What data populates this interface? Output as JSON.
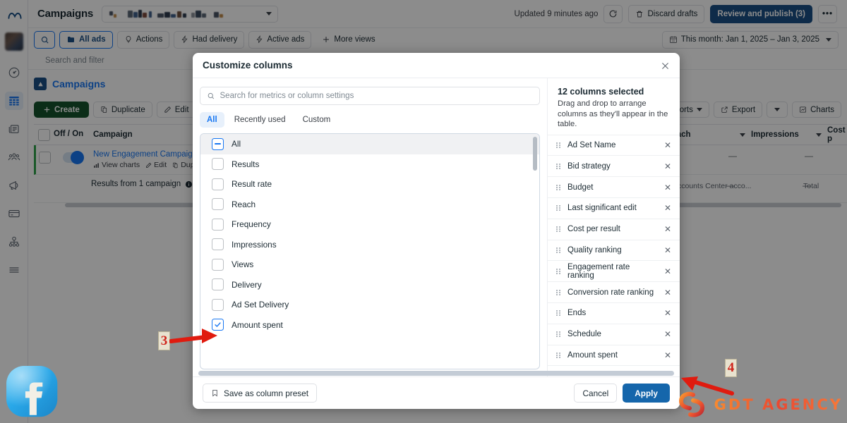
{
  "header": {
    "page_title": "Campaigns",
    "account_placeholder": "",
    "updated_text": "Updated 9 minutes ago",
    "refresh_icon": "refresh-icon",
    "discard_label": "Discard drafts",
    "review_label": "Review and publish (3)",
    "more_label": "•••",
    "date_range": "This month: Jan 1, 2025 – Jan 3, 2025"
  },
  "filters": {
    "search_icon": "search-icon",
    "chips": [
      {
        "label": "All ads",
        "icon": "folder-icon",
        "selected": true
      },
      {
        "label": "Actions",
        "icon": "bulb-icon",
        "selected": false
      },
      {
        "label": "Had delivery",
        "icon": "bolt-icon",
        "selected": false
      },
      {
        "label": "Active ads",
        "icon": "bolt-icon",
        "selected": false
      },
      {
        "label": "More views",
        "icon": "plus-icon",
        "selected": false
      }
    ],
    "search_and_filter": "Search and filter"
  },
  "campaigns_section": {
    "title": "Campaigns",
    "buttons": [
      {
        "label": "Create",
        "icon": "plus-icon"
      },
      {
        "label": "Duplicate",
        "icon": "duplicate-icon"
      },
      {
        "label": "Edit",
        "icon": "pencil-icon"
      }
    ],
    "right_buttons": [
      {
        "label": "eports",
        "icon": "chevron-down-icon"
      },
      {
        "label": "Export",
        "icon": "export-icon"
      },
      {
        "label": "",
        "icon": "chevron-down-icon"
      },
      {
        "label": "Charts",
        "icon": "chart-icon"
      }
    ]
  },
  "table": {
    "columns": [
      "Off / On",
      "Campaign",
      "Reach",
      "Impressions",
      "Cost p"
    ],
    "rows": [
      {
        "campaign": "New Engagement Campaign",
        "row_actions": [
          "View charts",
          "Edit",
          "Dupl"
        ],
        "reach": "—",
        "impressions": "—"
      }
    ],
    "summary": {
      "label": "Results from 1 campaign",
      "accounts": "Accounts Center acco...",
      "reach": "—",
      "impressions": "—",
      "total_label": "Total"
    }
  },
  "modal": {
    "title": "Customize columns",
    "close_icon": "close-icon",
    "search_placeholder": "Search for metrics or column settings",
    "search_value": "",
    "tabs": [
      {
        "label": "All",
        "active": true
      },
      {
        "label": "Recently used",
        "active": false
      },
      {
        "label": "Custom",
        "active": false
      }
    ],
    "metrics": [
      {
        "label": "All",
        "state": "indeterminate",
        "header": true
      },
      {
        "label": "Results",
        "state": "unchecked"
      },
      {
        "label": "Result rate",
        "state": "unchecked"
      },
      {
        "label": "Reach",
        "state": "unchecked"
      },
      {
        "label": "Frequency",
        "state": "unchecked"
      },
      {
        "label": "Impressions",
        "state": "unchecked"
      },
      {
        "label": "Views",
        "state": "unchecked"
      },
      {
        "label": "Delivery",
        "state": "unchecked"
      },
      {
        "label": "Ad Set Delivery",
        "state": "unchecked"
      },
      {
        "label": "Amount spent",
        "state": "checked"
      }
    ],
    "selected_panel": {
      "heading": "12 columns selected",
      "subtext": "Drag and drop to arrange columns as they'll appear in the table.",
      "items": [
        "Ad Set Name",
        "Bid strategy",
        "Budget",
        "Last significant edit",
        "Cost per result",
        "Quality ranking",
        "Engagement rate ranking",
        "Conversion rate ranking",
        "Ends",
        "Schedule",
        "Amount spent"
      ],
      "remove_icon": "close-icon",
      "drag_icon": "drag-handle-icon"
    },
    "footer": {
      "save_preset": "Save as column preset",
      "save_preset_icon": "bookmark-icon",
      "cancel": "Cancel",
      "apply": "Apply"
    }
  },
  "annotations": [
    {
      "number": "3",
      "target": "amount-spent-checkbox"
    },
    {
      "number": "4",
      "target": "apply-button"
    }
  ],
  "watermarks": {
    "facebook": "facebook-logo",
    "agency_text": "GDT AGENCY"
  },
  "sidebar": {
    "items": [
      {
        "icon": "avatar",
        "label": "account-avatar",
        "active": false
      },
      {
        "icon": "gauge-icon",
        "label": "dashboard",
        "active": false
      },
      {
        "icon": "table-icon",
        "label": "campaigns-table",
        "active": true
      },
      {
        "icon": "news-icon",
        "label": "reports",
        "active": false
      },
      {
        "icon": "people-icon",
        "label": "audiences",
        "active": false
      },
      {
        "icon": "megaphone-icon",
        "label": "ads",
        "active": false
      },
      {
        "icon": "card-icon",
        "label": "billing",
        "active": false
      },
      {
        "icon": "network-icon",
        "label": "events",
        "active": false
      },
      {
        "icon": "menu-icon",
        "label": "all-tools",
        "active": false
      }
    ]
  },
  "colors": {
    "accent_blue": "#1877f2",
    "primary_button": "#1566ab",
    "review_button": "#1b4f85",
    "create_green": "#14532d",
    "annotation_red": "#d0241b"
  }
}
